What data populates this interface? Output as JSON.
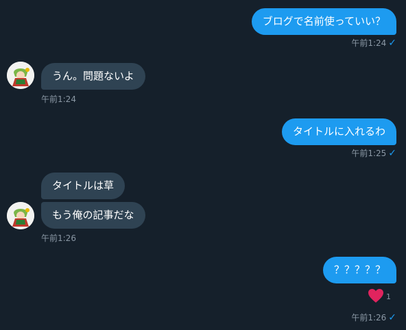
{
  "messages": [
    {
      "text": "ブログで名前使っていい？",
      "time": "午前1:24"
    },
    {
      "text": "うん。問題ないよ",
      "time": "午前1:24"
    },
    {
      "text": "タイトルに入れるわ",
      "time": "午前1:25"
    },
    {
      "text": "タイトルは草"
    },
    {
      "text": "もう俺の記事だな",
      "time": "午前1:26"
    },
    {
      "text": "？？？？？",
      "time": "午前1:26",
      "reaction": {
        "icon": "heart-icon",
        "count": "1"
      }
    }
  ],
  "colors": {
    "background": "#15202b",
    "outgoing_bubble": "#1d9bf0",
    "incoming_bubble": "#2f4353",
    "timestamp": "#8b98a5",
    "heart": "#f91880"
  },
  "icons": {
    "read_receipt": "check-icon",
    "avatar": "avatar"
  },
  "read_mark": "✓"
}
